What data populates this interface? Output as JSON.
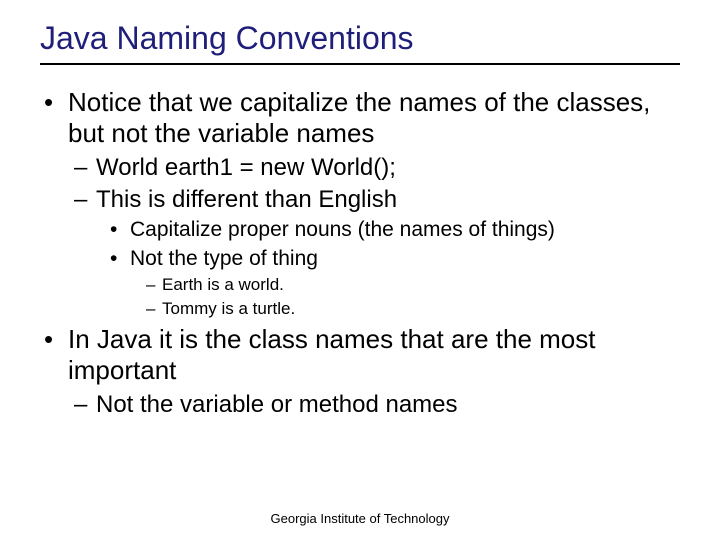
{
  "title": "Java Naming Conventions",
  "bullets": {
    "b1": "Notice that we capitalize the names of the classes, but not the variable names",
    "b1_1": "World earth1 = new World();",
    "b1_2": "This is different than English",
    "b1_2_1": "Capitalize proper nouns (the names of things)",
    "b1_2_2": "Not the type of thing",
    "b1_2_2_1": "Earth is a world.",
    "b1_2_2_2": "Tommy is a turtle.",
    "b2": "In Java it is the class names that are the most important",
    "b2_1": "Not the variable or method names"
  },
  "footer": "Georgia Institute of Technology"
}
